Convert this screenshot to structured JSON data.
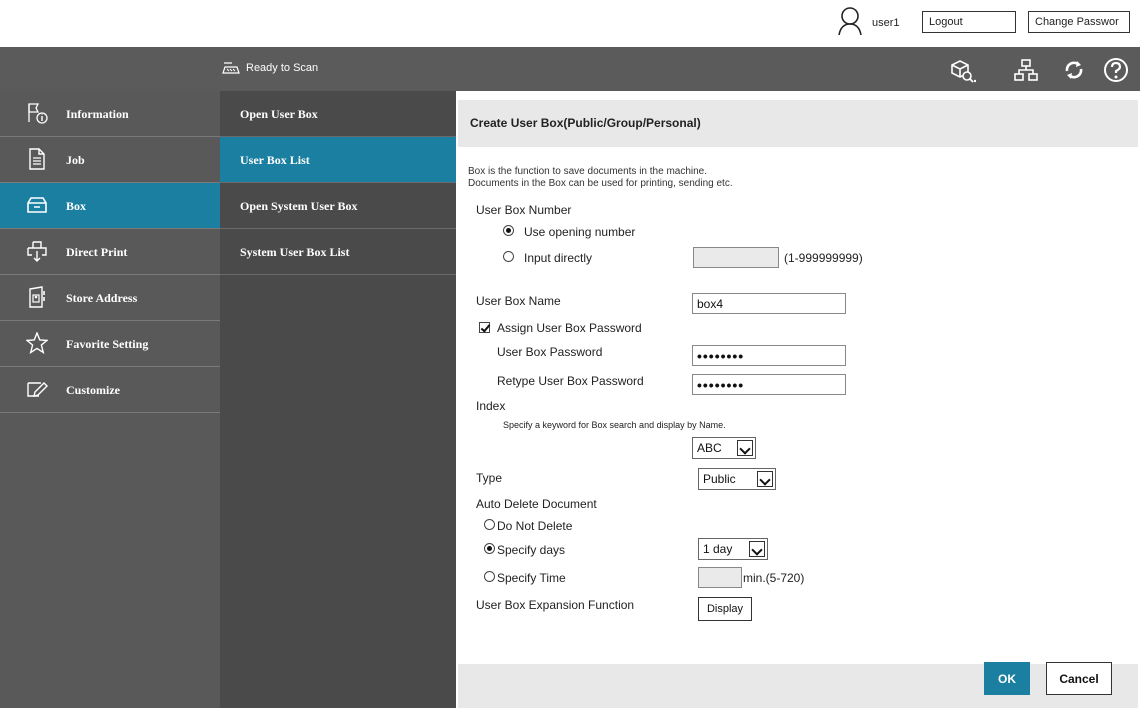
{
  "topbar": {
    "user_icon": "user-icon",
    "username": "user1",
    "logout_label": "Logout",
    "change_password_label": "Change Passwor"
  },
  "statusbar": {
    "scan_icon": "scanner-icon",
    "status_text": "Ready to Scan",
    "icons": [
      "search-device-icon",
      "network-icon",
      "refresh-icon",
      "help-icon"
    ]
  },
  "leftnav": {
    "items": [
      {
        "label": "Information",
        "icon": "information-icon",
        "active": false
      },
      {
        "label": "Job",
        "icon": "job-icon",
        "active": false
      },
      {
        "label": "Box",
        "icon": "box-icon",
        "active": true
      },
      {
        "label": "Direct Print",
        "icon": "direct-print-icon",
        "active": false
      },
      {
        "label": "Store Address",
        "icon": "store-address-icon",
        "active": false
      },
      {
        "label": "Favorite Setting",
        "icon": "star-icon",
        "active": false
      },
      {
        "label": "Customize",
        "icon": "customize-icon",
        "active": false
      }
    ]
  },
  "subnav": {
    "items": [
      {
        "label": "Open User Box",
        "active": false
      },
      {
        "label": "User Box List",
        "active": true
      },
      {
        "label": "Open System User Box",
        "active": false
      },
      {
        "label": "System User Box List",
        "active": false
      }
    ]
  },
  "main": {
    "title": "Create User Box(Public/Group/Personal)",
    "desc_line1": "Box is the function to save documents in the machine.",
    "desc_line2": "Documents in the Box can be used for printing, sending etc.",
    "box_number": {
      "label": "User Box Number",
      "opt_opening": "Use opening number",
      "opt_direct": "Input directly",
      "direct_value": "",
      "range_hint": "(1-999999999)",
      "selected": "opening"
    },
    "box_name": {
      "label": "User Box Name",
      "value": "box4"
    },
    "assign_password": {
      "label": "Assign User Box Password",
      "checked": true
    },
    "password": {
      "label": "User Box Password",
      "value": "••••••••"
    },
    "retype_password": {
      "label": "Retype User Box Password",
      "value": "••••••••"
    },
    "index": {
      "label": "Index",
      "hint": "Specify a keyword for Box search and display by Name.",
      "value": "ABC"
    },
    "type": {
      "label": "Type",
      "value": "Public"
    },
    "auto_delete": {
      "label": "Auto Delete Document",
      "opt_none": "Do Not Delete",
      "opt_days": "Specify days",
      "opt_time": "Specify Time",
      "days_value": "1 day",
      "time_value": "",
      "time_hint": "min.(5-720)",
      "selected": "days"
    },
    "expansion": {
      "label": "User Box Expansion Function",
      "button": "Display"
    },
    "ok_label": "OK",
    "cancel_label": "Cancel"
  }
}
